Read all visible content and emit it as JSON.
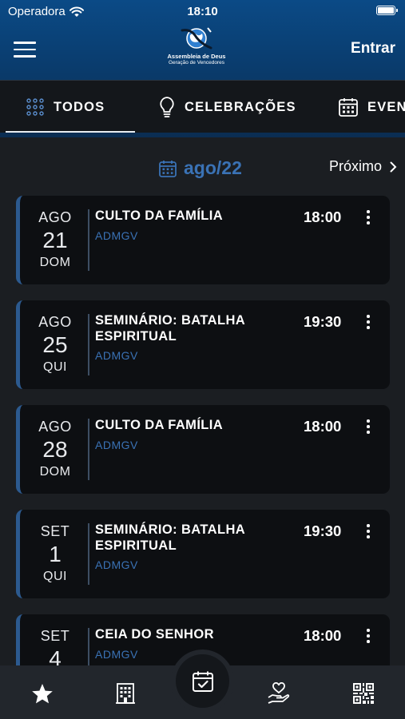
{
  "status_bar": {
    "carrier": "Operadora",
    "time": "18:10"
  },
  "header": {
    "logo_line1": "Assembleia de Deus",
    "logo_line2": "Geração de Vencedores",
    "login_label": "Entrar"
  },
  "tabs": [
    {
      "label": "TODOS",
      "icon": "grid-dots-icon",
      "active": true
    },
    {
      "label": "CELEBRAÇÕES",
      "icon": "lightbulb-icon",
      "active": false
    },
    {
      "label": "EVEN",
      "icon": "calendar-icon",
      "active": false
    }
  ],
  "month_bar": {
    "month": "ago/22",
    "next_label": "Próximo"
  },
  "events": [
    {
      "month": "AGO",
      "day": "21",
      "weekday": "DOM",
      "title": "CULTO DA FAMÍLIA",
      "org": "ADMGV",
      "time": "18:00"
    },
    {
      "month": "AGO",
      "day": "25",
      "weekday": "QUI",
      "title": "SEMINÁRIO: BATALHA ESPIRITUAL",
      "org": "ADMGV",
      "time": "19:30"
    },
    {
      "month": "AGO",
      "day": "28",
      "weekday": "DOM",
      "title": "CULTO DA FAMÍLIA",
      "org": "ADMGV",
      "time": "18:00"
    },
    {
      "month": "SET",
      "day": "1",
      "weekday": "QUI",
      "title": "SEMINÁRIO: BATALHA ESPIRITUAL",
      "org": "ADMGV",
      "time": "19:30"
    },
    {
      "month": "SET",
      "day": "4",
      "weekday": "",
      "title": "CEIA DO SENHOR",
      "org": "ADMGV",
      "time": "18:00"
    }
  ],
  "bottom_nav": [
    {
      "icon": "star-icon"
    },
    {
      "icon": "building-icon"
    },
    {
      "icon": "calendar-check-icon",
      "active": true
    },
    {
      "icon": "heart-hand-icon"
    },
    {
      "icon": "qr-code-icon"
    }
  ],
  "colors": {
    "accent": "#3a72b5",
    "header": "#0b4a86",
    "card": "#0d0f12",
    "background": "#1b1e22"
  }
}
